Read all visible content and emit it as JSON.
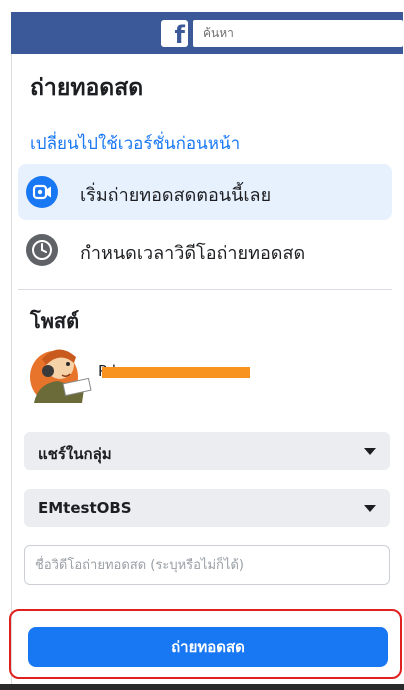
{
  "header": {
    "logo": "f",
    "search_placeholder": "ค้นหา"
  },
  "page": {
    "title": "ถ่ายทอดสด",
    "switch_link": "เปลี่ยนไปใช้เวอร์ชั่นก่อนหน้า"
  },
  "options": [
    {
      "label": "เริ่มถ่ายทอดสดตอนนี้เลย",
      "icon": "live-camera-icon",
      "selected": true
    },
    {
      "label": "กำหนดเวลาวิดีโอถ่ายทอดสด",
      "icon": "clock-icon",
      "selected": false
    }
  ],
  "post": {
    "heading": "โพสต์",
    "author": "P                                k"
  },
  "selects": {
    "share_to": "แชร์ในกลุ่ม",
    "group": "EMtestOBS"
  },
  "video_title": {
    "value": "",
    "placeholder": "ชื่อวิดีโอถ่ายทอดสด (ระบุหรือไม่ก็ได้)"
  },
  "actions": {
    "go_live": "ถ่ายทอดสด"
  },
  "colors": {
    "header": "#3b5998",
    "accent": "#1877f2",
    "highlight": "#e02020",
    "selected_bg": "#e7f0fd"
  }
}
